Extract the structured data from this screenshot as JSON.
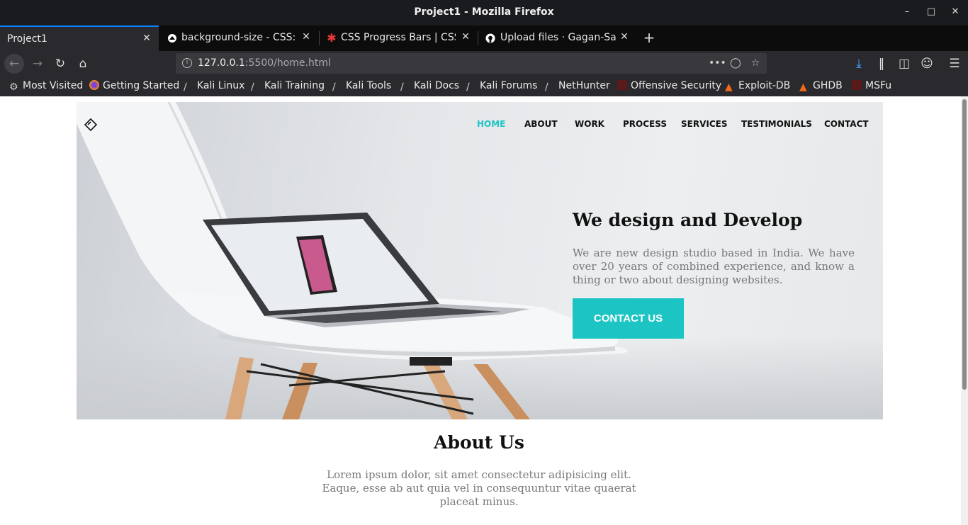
{
  "window": {
    "title": "Project1 - Mozilla Firefox"
  },
  "tabs": [
    {
      "label": "Project1",
      "active": true
    },
    {
      "label": "background-size - CSS: C"
    },
    {
      "label": "CSS Progress Bars | CSS"
    },
    {
      "label": "Upload files · Gagan-Saff"
    }
  ],
  "navbar": {
    "url_host": "127.0.0.1",
    "url_path": ":5500/home.html"
  },
  "bookmarks": [
    "Most Visited",
    "Getting Started",
    "Kali Linux",
    "Kali Training",
    "Kali Tools",
    "Kali Docs",
    "Kali Forums",
    "NetHunter",
    "Offensive Security",
    "Exploit-DB",
    "GHDB",
    "MSFu"
  ],
  "site": {
    "menu": [
      "HOME",
      "ABOUT",
      "WORK",
      "PROCESS",
      "SERVICES",
      "TESTIMONIALS",
      "CONTACT"
    ],
    "active_menu": "HOME",
    "accent_color": "#1dc4c4",
    "hero": {
      "title": "We design and Develop",
      "text": "We are new design studio based in India. We have over 20 years of combined experience, and know a thing or two about designing websites.",
      "button": "CONTACT US"
    },
    "about": {
      "title": "About Us",
      "text": "Lorem ipsum dolor, sit amet consectetur adipisicing elit. Eaque, esse ab aut quia vel in consequuntur vitae quaerat placeat minus."
    }
  }
}
